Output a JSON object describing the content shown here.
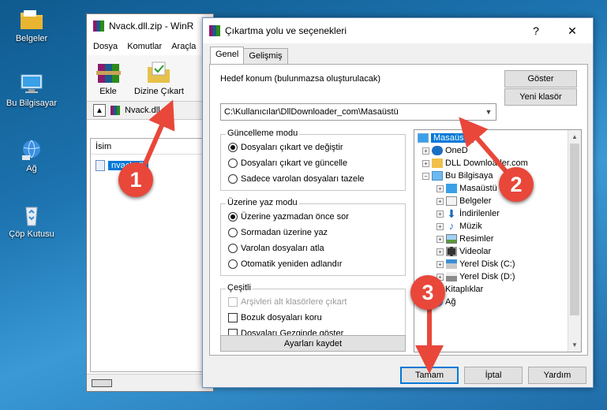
{
  "desktop": {
    "icons": [
      {
        "label": "Belgeler"
      },
      {
        "label": "Bu Bilgisayar"
      },
      {
        "label": "Ağ"
      },
      {
        "label": "Çöp Kutusu"
      }
    ]
  },
  "winrar": {
    "title": "Nvack.dll.zip - WinR",
    "menu": [
      "Dosya",
      "Komutlar",
      "Araçla"
    ],
    "toolbar": {
      "add": "Ekle",
      "extract_to": "Dizine Çıkart"
    },
    "path": "Nvack.dll.z",
    "column": "İsim",
    "file": "nvack.dll"
  },
  "dialog": {
    "title": "Çıkartma yolu ve seçenekleri",
    "help": "?",
    "close": "✕",
    "tabs": [
      "Genel",
      "Gelişmiş"
    ],
    "dest_label": "Hedef konum (bulunmazsa oluşturulacak)",
    "dest_value": "C:\\Kullanıcılar\\DllDownloader_com\\Masaüstü",
    "show_btn": "Göster",
    "new_folder_btn": "Yeni klasör",
    "update_group": {
      "title": "Güncelleme modu",
      "options": [
        "Dosyaları çıkart ve değiştir",
        "Dosyaları çıkart ve güncelle",
        "Sadece varolan dosyaları tazele"
      ],
      "selected": 0
    },
    "overwrite_group": {
      "title": "Üzerine yaz modu",
      "options": [
        "Üzerine yazmadan önce sor",
        "Sormadan üzerine yaz",
        "Varolan dosyaları atla",
        "Otomatik yeniden adlandır"
      ],
      "selected": 0
    },
    "misc_group": {
      "title": "Çeşitli",
      "options": [
        "Arşivleri alt klasörlere çıkart",
        "Bozuk dosyaları koru",
        "Dosyaları Gezginde göster"
      ]
    },
    "save_settings_btn": "Ayarları kaydet",
    "tree": [
      "Masaüstü",
      "OneD",
      "DLL Downloader.com",
      "Bu Bilgisaya",
      "Masaüstü",
      "Belgeler",
      "İndirilenler",
      "Müzik",
      "Resimler",
      "Videolar",
      "Yerel Disk (C:)",
      "Yerel Disk (D:)",
      "Kitaplıklar",
      "Ağ"
    ],
    "ok_btn": "Tamam",
    "cancel_btn": "İptal",
    "help_btn": "Yardım"
  },
  "callouts": [
    "1",
    "2",
    "3"
  ],
  "colors": {
    "accent": "#0078d7",
    "callout": "#e8473a"
  }
}
